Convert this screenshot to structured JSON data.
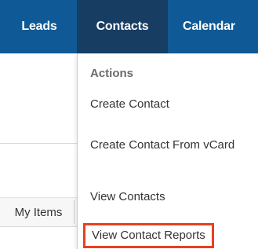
{
  "nav": {
    "tabs": [
      {
        "label": "Leads"
      },
      {
        "label": "Contacts"
      },
      {
        "label": "Calendar"
      }
    ],
    "active_tab": "Contacts",
    "bar_color": "#0f5a96",
    "active_color": "#173d63"
  },
  "background": {
    "my_items_label": "My Items"
  },
  "dropdown": {
    "header": "Actions",
    "items": [
      {
        "label": "Create Contact"
      },
      {
        "label": "Create Contact From vCard"
      },
      {
        "label": "View Contacts"
      },
      {
        "label": "View Contact Reports",
        "highlighted": true
      }
    ],
    "highlight_color": "#e8411f"
  }
}
